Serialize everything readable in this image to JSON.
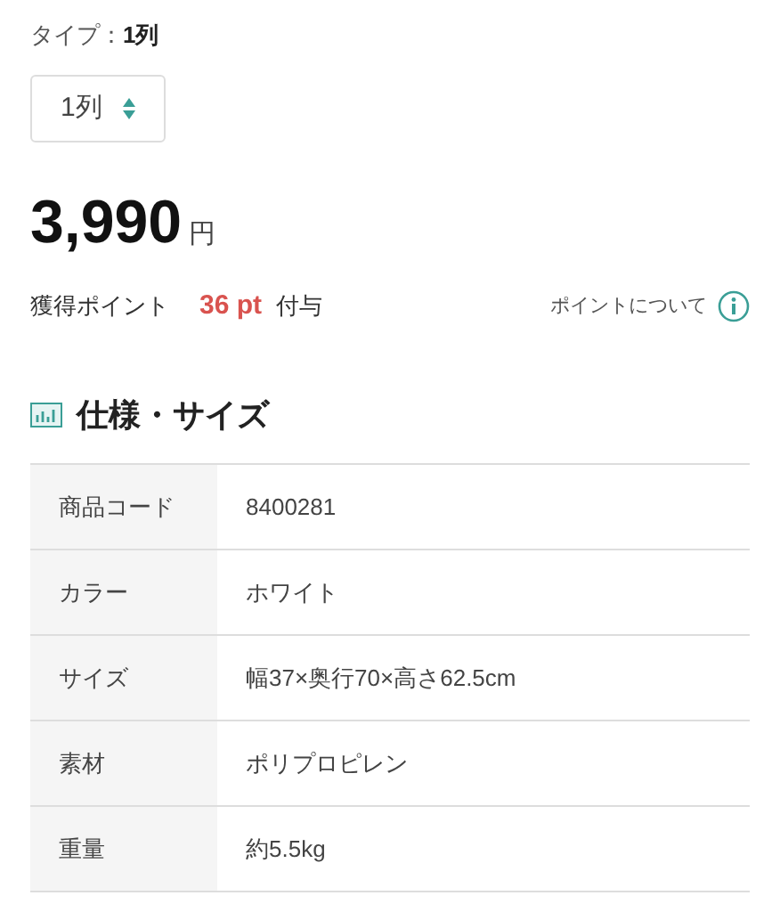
{
  "type_label": "タイプ：",
  "type_value": "1列",
  "select": {
    "value": "1列"
  },
  "price": {
    "amount": "3,990",
    "unit": "円"
  },
  "points": {
    "label": "獲得ポイント",
    "value": "36 pt",
    "suffix": "付与",
    "about_link": "ポイントについて"
  },
  "spec_heading": "仕様・サイズ",
  "spec_rows": [
    {
      "label": "商品コード",
      "value": "8400281"
    },
    {
      "label": "カラー",
      "value": "ホワイト"
    },
    {
      "label": "サイズ",
      "value": "幅37×奥行70×高さ62.5cm"
    },
    {
      "label": "素材",
      "value": "ポリプロピレン"
    },
    {
      "label": "重量",
      "value": "約5.5kg"
    }
  ]
}
